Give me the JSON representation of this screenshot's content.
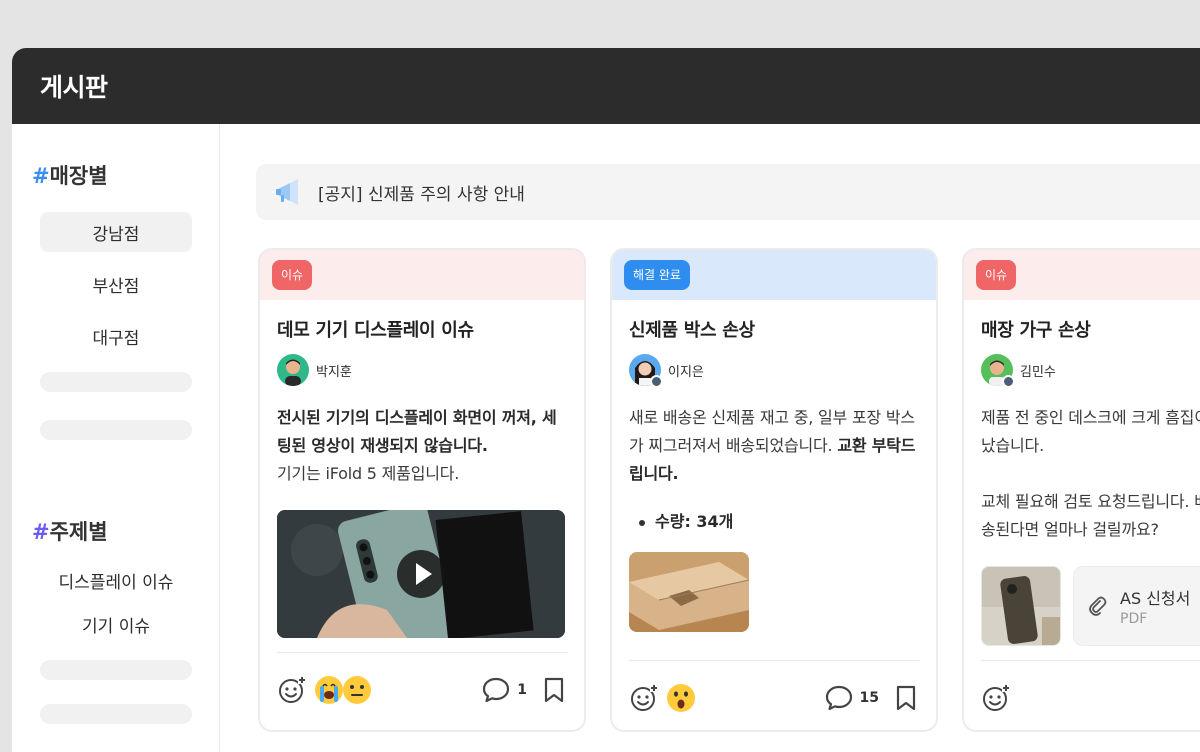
{
  "app": {
    "title": "게시판"
  },
  "sidebar": {
    "store_section": {
      "hash": "#",
      "label": "매장별",
      "items": [
        "강남점",
        "부산점",
        "대구점"
      ],
      "active": "강남점"
    },
    "topic_section": {
      "hash": "#",
      "label": "주제별",
      "items": [
        "디스플레이 이슈",
        "기기 이슈"
      ]
    }
  },
  "notice": {
    "icon": "megaphone-icon",
    "text": "[공지] 신제품 주의 사항 안내"
  },
  "cards": [
    {
      "badge": "이슈",
      "title": "데모 기기 디스플레이 이슈",
      "author": "박지훈",
      "content_bold": "전시된 기기의 디스플레이 화면이 꺼져, 세팅된 영상이 재생되지 않습니다.",
      "content_plain": "기기는 iFold 5 제품입니다.",
      "comments": "1"
    },
    {
      "badge": "해결 완료",
      "title": "신제품 박스 손상",
      "author": "이지은",
      "content_plain": "새로 배송온 신제품 재고 중, 일부 포장 박스가 찌그러져서 배송되었습니다.",
      "content_bold": "교환 부탁드립니다.",
      "bullet": "수량: 34개",
      "comments": "15"
    },
    {
      "badge": "이슈",
      "title": "매장 가구 손상",
      "author": "김민수",
      "content_line1": "제품 전 중인 데스크에 크게 흠집이 났습니다.",
      "content_line2": "교체 필요해 검토 요청드립니다. 배송된다면 얼마나 걸릴까요?",
      "attachment": {
        "name": "AS 신청서",
        "ext": "PDF"
      }
    }
  ],
  "colors": {
    "issue": "#f06565",
    "done": "#2f8df0",
    "topbar": "#2c2c2c"
  }
}
